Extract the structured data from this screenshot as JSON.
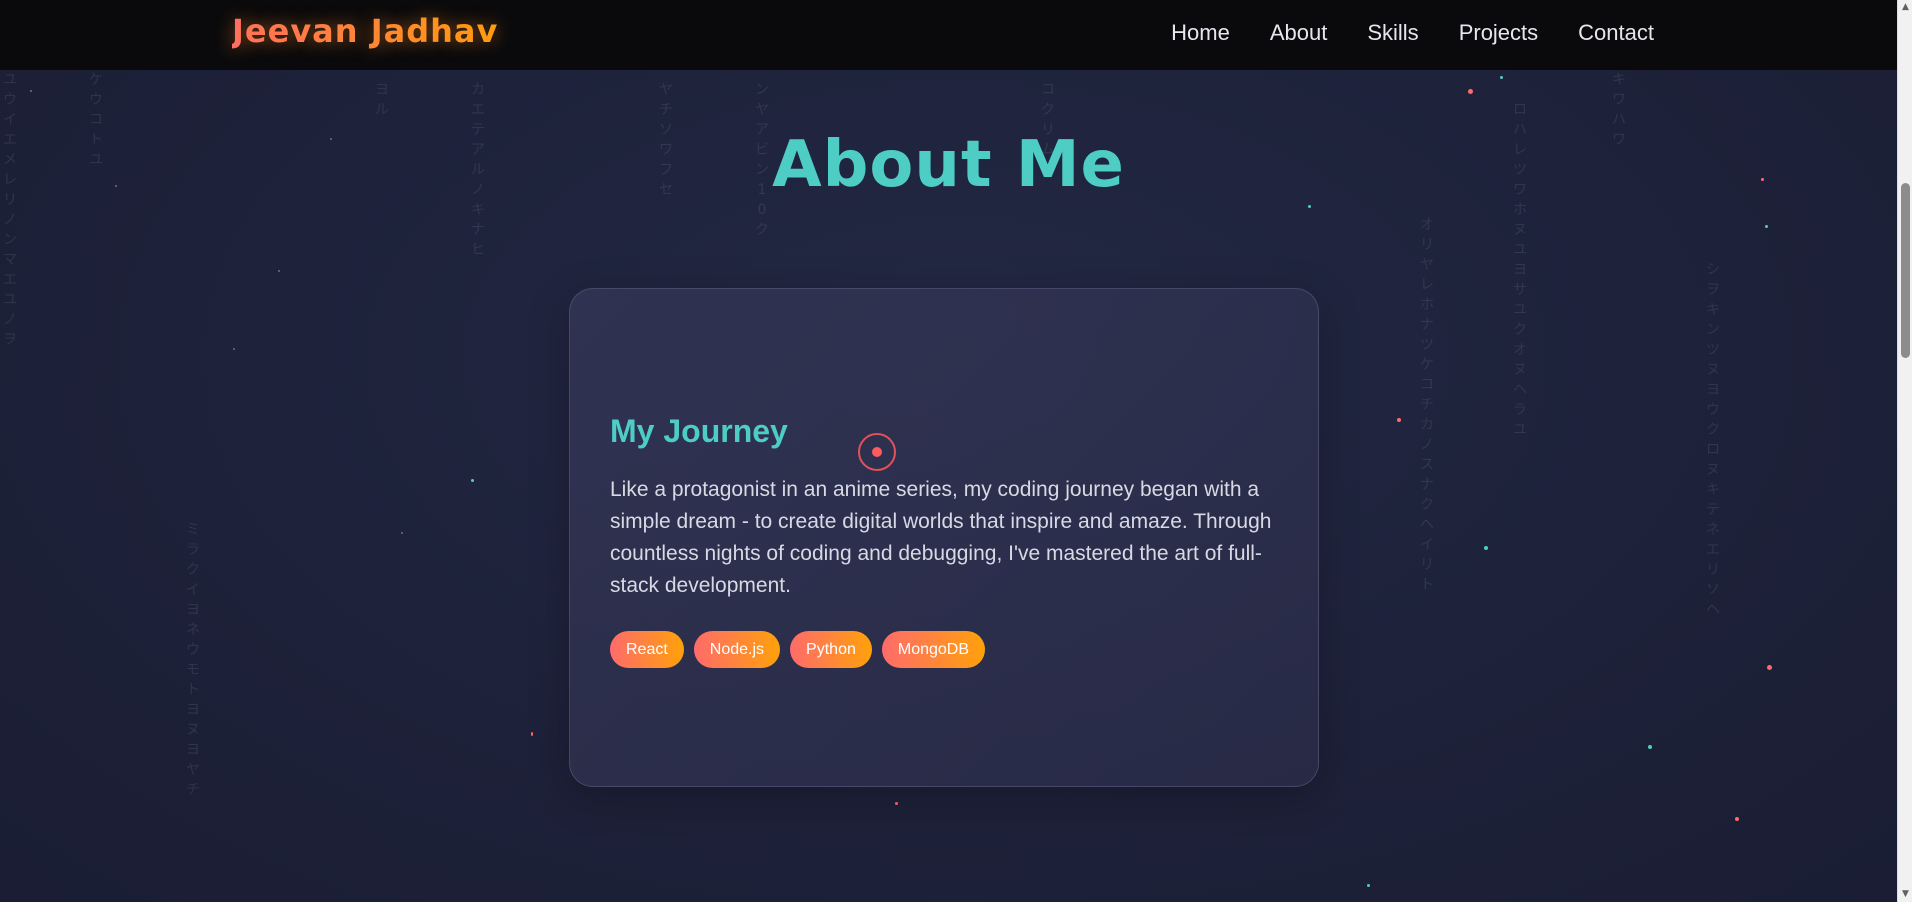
{
  "brand": {
    "name": "Jeevan Jadhav"
  },
  "nav": {
    "items": [
      {
        "label": "Home"
      },
      {
        "label": "About"
      },
      {
        "label": "Skills"
      },
      {
        "label": "Projects"
      },
      {
        "label": "Contact"
      }
    ]
  },
  "about": {
    "title": "About Me",
    "card": {
      "heading": "My Journey",
      "text": "Like a protagonist in an anime series, my coding journey began with a simple dream - to create digital worlds that inspire and amaze. Through countless nights of coding and debugging, I've mastered the art of full-stack development.",
      "tags": [
        {
          "label": "React"
        },
        {
          "label": "Node.js"
        },
        {
          "label": "Python"
        },
        {
          "label": "MongoDB"
        }
      ]
    }
  },
  "background": {
    "kana_columns": [
      "ユウイエメレリノンマエユノヲ",
      "ケウコトユ",
      "ヨル",
      "カエテアルノキナヒ",
      "ヤチソワフセ",
      "ンヤアビン10ク",
      "コクリム",
      "オリヤレホナツケコチカノスナクヘイリト",
      "ロハレツワホヌユヨサユクオヌヘラユ",
      "キワハワ",
      "シヲキンツヌヨウクロヌキテネエリソヘ",
      "ミラクイヨネウモトヨヌヨヤチ"
    ]
  },
  "colors": {
    "accent_teal": "#4ecdc4",
    "accent_gradient_start": "#ff6b6b",
    "accent_gradient_end": "#ffa10a",
    "background": "#1d2139",
    "navbar": "#0a0a0c"
  },
  "icons": [
    "cursor-ring-icon",
    "scroll-up-arrow-icon",
    "scroll-down-arrow-icon"
  ]
}
